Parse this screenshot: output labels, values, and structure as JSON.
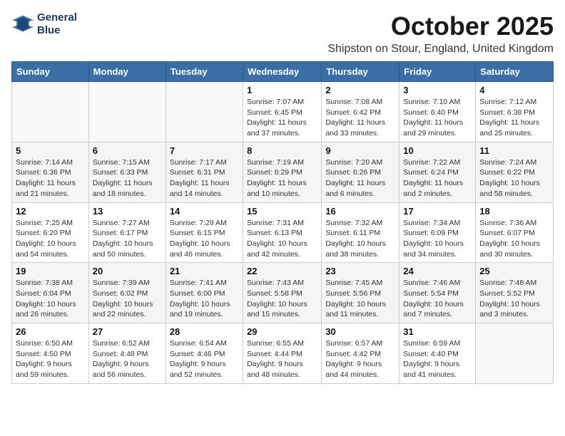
{
  "logo": {
    "line1": "General",
    "line2": "Blue"
  },
  "title": "October 2025",
  "location": "Shipston on Stour, England, United Kingdom",
  "days_of_week": [
    "Sunday",
    "Monday",
    "Tuesday",
    "Wednesday",
    "Thursday",
    "Friday",
    "Saturday"
  ],
  "weeks": [
    [
      {
        "day": "",
        "info": ""
      },
      {
        "day": "",
        "info": ""
      },
      {
        "day": "",
        "info": ""
      },
      {
        "day": "1",
        "info": "Sunrise: 7:07 AM\nSunset: 6:45 PM\nDaylight: 11 hours\nand 37 minutes."
      },
      {
        "day": "2",
        "info": "Sunrise: 7:08 AM\nSunset: 6:42 PM\nDaylight: 11 hours\nand 33 minutes."
      },
      {
        "day": "3",
        "info": "Sunrise: 7:10 AM\nSunset: 6:40 PM\nDaylight: 11 hours\nand 29 minutes."
      },
      {
        "day": "4",
        "info": "Sunrise: 7:12 AM\nSunset: 6:38 PM\nDaylight: 11 hours\nand 25 minutes."
      }
    ],
    [
      {
        "day": "5",
        "info": "Sunrise: 7:14 AM\nSunset: 6:36 PM\nDaylight: 11 hours\nand 21 minutes."
      },
      {
        "day": "6",
        "info": "Sunrise: 7:15 AM\nSunset: 6:33 PM\nDaylight: 11 hours\nand 18 minutes."
      },
      {
        "day": "7",
        "info": "Sunrise: 7:17 AM\nSunset: 6:31 PM\nDaylight: 11 hours\nand 14 minutes."
      },
      {
        "day": "8",
        "info": "Sunrise: 7:19 AM\nSunset: 6:29 PM\nDaylight: 11 hours\nand 10 minutes."
      },
      {
        "day": "9",
        "info": "Sunrise: 7:20 AM\nSunset: 6:26 PM\nDaylight: 11 hours\nand 6 minutes."
      },
      {
        "day": "10",
        "info": "Sunrise: 7:22 AM\nSunset: 6:24 PM\nDaylight: 11 hours\nand 2 minutes."
      },
      {
        "day": "11",
        "info": "Sunrise: 7:24 AM\nSunset: 6:22 PM\nDaylight: 10 hours\nand 58 minutes."
      }
    ],
    [
      {
        "day": "12",
        "info": "Sunrise: 7:25 AM\nSunset: 6:20 PM\nDaylight: 10 hours\nand 54 minutes."
      },
      {
        "day": "13",
        "info": "Sunrise: 7:27 AM\nSunset: 6:17 PM\nDaylight: 10 hours\nand 50 minutes."
      },
      {
        "day": "14",
        "info": "Sunrise: 7:29 AM\nSunset: 6:15 PM\nDaylight: 10 hours\nand 46 minutes."
      },
      {
        "day": "15",
        "info": "Sunrise: 7:31 AM\nSunset: 6:13 PM\nDaylight: 10 hours\nand 42 minutes."
      },
      {
        "day": "16",
        "info": "Sunrise: 7:32 AM\nSunset: 6:11 PM\nDaylight: 10 hours\nand 38 minutes."
      },
      {
        "day": "17",
        "info": "Sunrise: 7:34 AM\nSunset: 6:09 PM\nDaylight: 10 hours\nand 34 minutes."
      },
      {
        "day": "18",
        "info": "Sunrise: 7:36 AM\nSunset: 6:07 PM\nDaylight: 10 hours\nand 30 minutes."
      }
    ],
    [
      {
        "day": "19",
        "info": "Sunrise: 7:38 AM\nSunset: 6:04 PM\nDaylight: 10 hours\nand 26 minutes."
      },
      {
        "day": "20",
        "info": "Sunrise: 7:39 AM\nSunset: 6:02 PM\nDaylight: 10 hours\nand 22 minutes."
      },
      {
        "day": "21",
        "info": "Sunrise: 7:41 AM\nSunset: 6:00 PM\nDaylight: 10 hours\nand 19 minutes."
      },
      {
        "day": "22",
        "info": "Sunrise: 7:43 AM\nSunset: 5:58 PM\nDaylight: 10 hours\nand 15 minutes."
      },
      {
        "day": "23",
        "info": "Sunrise: 7:45 AM\nSunset: 5:56 PM\nDaylight: 10 hours\nand 11 minutes."
      },
      {
        "day": "24",
        "info": "Sunrise: 7:46 AM\nSunset: 5:54 PM\nDaylight: 10 hours\nand 7 minutes."
      },
      {
        "day": "25",
        "info": "Sunrise: 7:48 AM\nSunset: 5:52 PM\nDaylight: 10 hours\nand 3 minutes."
      }
    ],
    [
      {
        "day": "26",
        "info": "Sunrise: 6:50 AM\nSunset: 4:50 PM\nDaylight: 9 hours\nand 59 minutes."
      },
      {
        "day": "27",
        "info": "Sunrise: 6:52 AM\nSunset: 4:48 PM\nDaylight: 9 hours\nand 56 minutes."
      },
      {
        "day": "28",
        "info": "Sunrise: 6:54 AM\nSunset: 4:46 PM\nDaylight: 9 hours\nand 52 minutes."
      },
      {
        "day": "29",
        "info": "Sunrise: 6:55 AM\nSunset: 4:44 PM\nDaylight: 9 hours\nand 48 minutes."
      },
      {
        "day": "30",
        "info": "Sunrise: 6:57 AM\nSunset: 4:42 PM\nDaylight: 9 hours\nand 44 minutes."
      },
      {
        "day": "31",
        "info": "Sunrise: 6:59 AM\nSunset: 4:40 PM\nDaylight: 9 hours\nand 41 minutes."
      },
      {
        "day": "",
        "info": ""
      }
    ]
  ]
}
